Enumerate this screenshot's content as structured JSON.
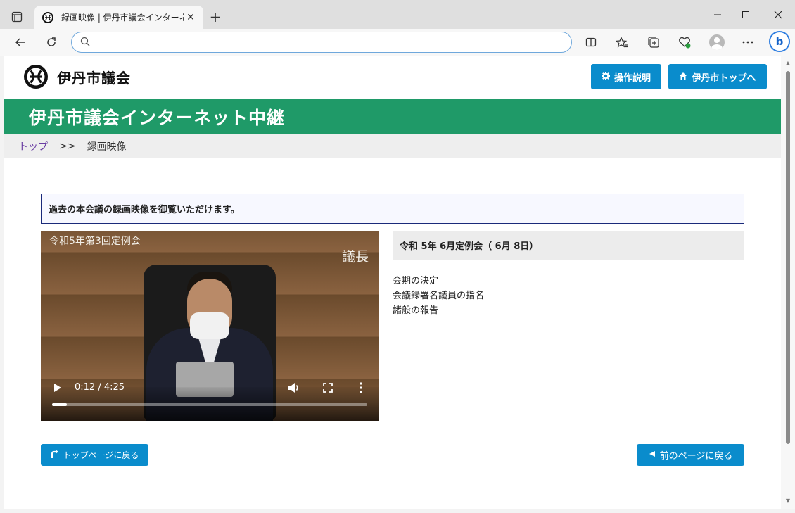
{
  "browser": {
    "tab_title": "録画映像 | 伊丹市議会インターネット中継",
    "new_tab_label": "+",
    "address": {
      "value": "",
      "placeholder": ""
    }
  },
  "site": {
    "logo_text": "伊丹市議会",
    "header_buttons": [
      {
        "label": "操作説明",
        "icon": "gear-icon"
      },
      {
        "label": "伊丹市トップへ",
        "icon": "home-icon"
      }
    ],
    "banner_title": "伊丹市議会インターネット中継",
    "breadcrumb": {
      "home": "トップ",
      "separator": ">>",
      "current": "録画映像"
    },
    "notice": "過去の本会議の録画映像を御覧いただけます。"
  },
  "video": {
    "overlay_title": "令和5年第3回定例会",
    "overlay_speaker": "議長",
    "time": "0:12 / 4:25",
    "progress": 0.047
  },
  "session": {
    "title": "令和 5年 6月定例会（ 6月 8日）",
    "agenda": [
      "会期の決定",
      "会議録署名議員の指名",
      "諸般の報告"
    ]
  },
  "nav": {
    "back_top": "トップページに戻る",
    "back_prev": "前のページに戻る"
  },
  "colors": {
    "accent": "#0a8ccc",
    "banner": "#1f9a68"
  }
}
